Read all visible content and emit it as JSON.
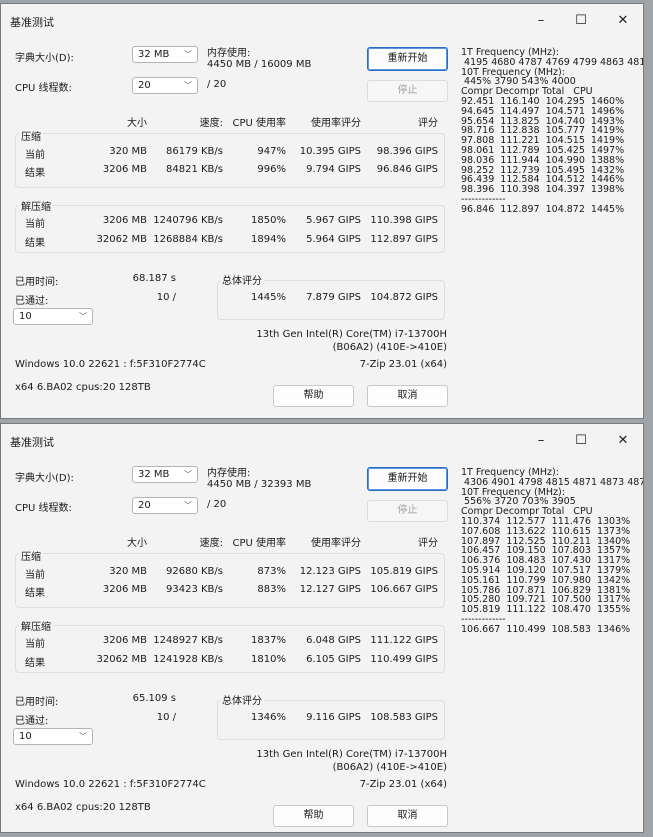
{
  "windows": [
    {
      "title": "基准测试",
      "controls": {
        "minimize": "–",
        "maximize": "☐",
        "close": "✕"
      },
      "dict_size_label": "字典大小(D):",
      "dict_size_value": "32 MB",
      "memory_label": "内存使用:",
      "memory_value": "4450 MB / 16009 MB",
      "restart_label": "重新开始",
      "threads_label": "CPU 线程数:",
      "threads_value": "20",
      "threads_total": "/ 20",
      "stop_label": "停止",
      "headers": {
        "size": "大小",
        "speed": "速度:",
        "cpu": "CPU 使用率",
        "rating": "使用率评分",
        "score": "评分"
      },
      "compress_label": "压缩",
      "decompress_label": "解压缩",
      "current_label": "当前",
      "result_label": "结果",
      "compress_current": {
        "size": "320 MB",
        "speed": "86179 KB/s",
        "cpu": "947%",
        "rating": "10.395 GIPS",
        "score": "98.396 GIPS"
      },
      "compress_result": {
        "size": "3206 MB",
        "speed": "84821 KB/s",
        "cpu": "996%",
        "rating": "9.794 GIPS",
        "score": "96.846 GIPS"
      },
      "decompress_current": {
        "size": "3206 MB",
        "speed": "1240796 KB/s",
        "cpu": "1850%",
        "rating": "5.967 GIPS",
        "score": "110.398 GIPS"
      },
      "decompress_result": {
        "size": "32062 MB",
        "speed": "1268884 KB/s",
        "cpu": "1894%",
        "rating": "5.964 GIPS",
        "score": "112.897 GIPS"
      },
      "elapsed_label": "已用时间:",
      "elapsed_value": "68.187 s",
      "passes_label": "已通过:",
      "passes_value": "10 /",
      "total_label": "总体评分",
      "total": {
        "cpu": "1445%",
        "rating": "7.879 GIPS",
        "score": "104.872 GIPS"
      },
      "passes_select": "10",
      "cpu_name_1": "13th Gen Intel(R) Core(TM) i7-13700H",
      "cpu_name_2": "(B06A2) (410E->410E)",
      "os_info": "Windows 10.0 22621 : f:5F310F2774C",
      "zip_version": "7-Zip 23.01 (x64)",
      "arch_info": "x64 6.BA02 cpus:20 128TB",
      "help_label": "帮助",
      "cancel_label": "取消",
      "freq_text": "1T Frequency (MHz):\n 4195 4680 4787 4769 4799 4863 4817\n10T Frequency (MHz):\n 445% 3790 543% 4000\nCompr Decompr Total   CPU\n92.451  116.140  104.295  1460%\n94.645  114.497  104.571  1496%\n95.654  113.825  104.740  1493%\n98.716  112.838  105.777  1419%\n97.808  111.221  104.515  1419%\n98.061  112.789  105.425  1497%\n98.036  111.944  104.990  1388%\n98.252  112.739  105.495  1432%\n96.439  112.584  104.512  1446%\n98.396  110.398  104.397  1398%\n-------------\n96.846  112.897  104.872  1445%"
    },
    {
      "title": "基准测试",
      "controls": {
        "minimize": "–",
        "maximize": "☐",
        "close": "✕"
      },
      "dict_size_label": "字典大小(D):",
      "dict_size_value": "32 MB",
      "memory_label": "内存使用:",
      "memory_value": "4450 MB / 32393 MB",
      "restart_label": "重新开始",
      "threads_label": "CPU 线程数:",
      "threads_value": "20",
      "threads_total": "/ 20",
      "stop_label": "停止",
      "headers": {
        "size": "大小",
        "speed": "速度:",
        "cpu": "CPU 使用率",
        "rating": "使用率评分",
        "score": "评分"
      },
      "compress_label": "压缩",
      "decompress_label": "解压缩",
      "current_label": "当前",
      "result_label": "结果",
      "compress_current": {
        "size": "320 MB",
        "speed": "92680 KB/s",
        "cpu": "873%",
        "rating": "12.123 GIPS",
        "score": "105.819 GIPS"
      },
      "compress_result": {
        "size": "3206 MB",
        "speed": "93423 KB/s",
        "cpu": "883%",
        "rating": "12.127 GIPS",
        "score": "106.667 GIPS"
      },
      "decompress_current": {
        "size": "3206 MB",
        "speed": "1248927 KB/s",
        "cpu": "1837%",
        "rating": "6.048 GIPS",
        "score": "111.122 GIPS"
      },
      "decompress_result": {
        "size": "32062 MB",
        "speed": "1241928 KB/s",
        "cpu": "1810%",
        "rating": "6.105 GIPS",
        "score": "110.499 GIPS"
      },
      "elapsed_label": "已用时间:",
      "elapsed_value": "65.109 s",
      "passes_label": "已通过:",
      "passes_value": "10 /",
      "total_label": "总体评分",
      "total": {
        "cpu": "1346%",
        "rating": "9.116 GIPS",
        "score": "108.583 GIPS"
      },
      "passes_select": "10",
      "cpu_name_1": "13th Gen Intel(R) Core(TM) i7-13700H",
      "cpu_name_2": "(B06A2) (410E->410E)",
      "os_info": "Windows 10.0 22621 : f:5F310F2774C",
      "zip_version": "7-Zip 23.01 (x64)",
      "arch_info": "x64 6.BA02 cpus:20 128TB",
      "help_label": "帮助",
      "cancel_label": "取消",
      "freq_text": "1T Frequency (MHz):\n 4306 4901 4798 4815 4871 4873 4879\n10T Frequency (MHz):\n 556% 3720 703% 3905\nCompr Decompr Total   CPU\n110.374  112.577  111.476  1303%\n107.608  113.622  110.615  1373%\n107.897  112.525  110.211  1340%\n106.457  109.150  107.803  1357%\n106.376  108.483  107.430  1317%\n105.914  109.120  107.517  1379%\n105.161  110.799  107.980  1342%\n105.786  107.871  106.829  1381%\n105.280  109.721  107.500  1317%\n105.819  111.122  108.470  1355%\n-------------\n106.667  110.499  108.583  1346%"
    }
  ]
}
